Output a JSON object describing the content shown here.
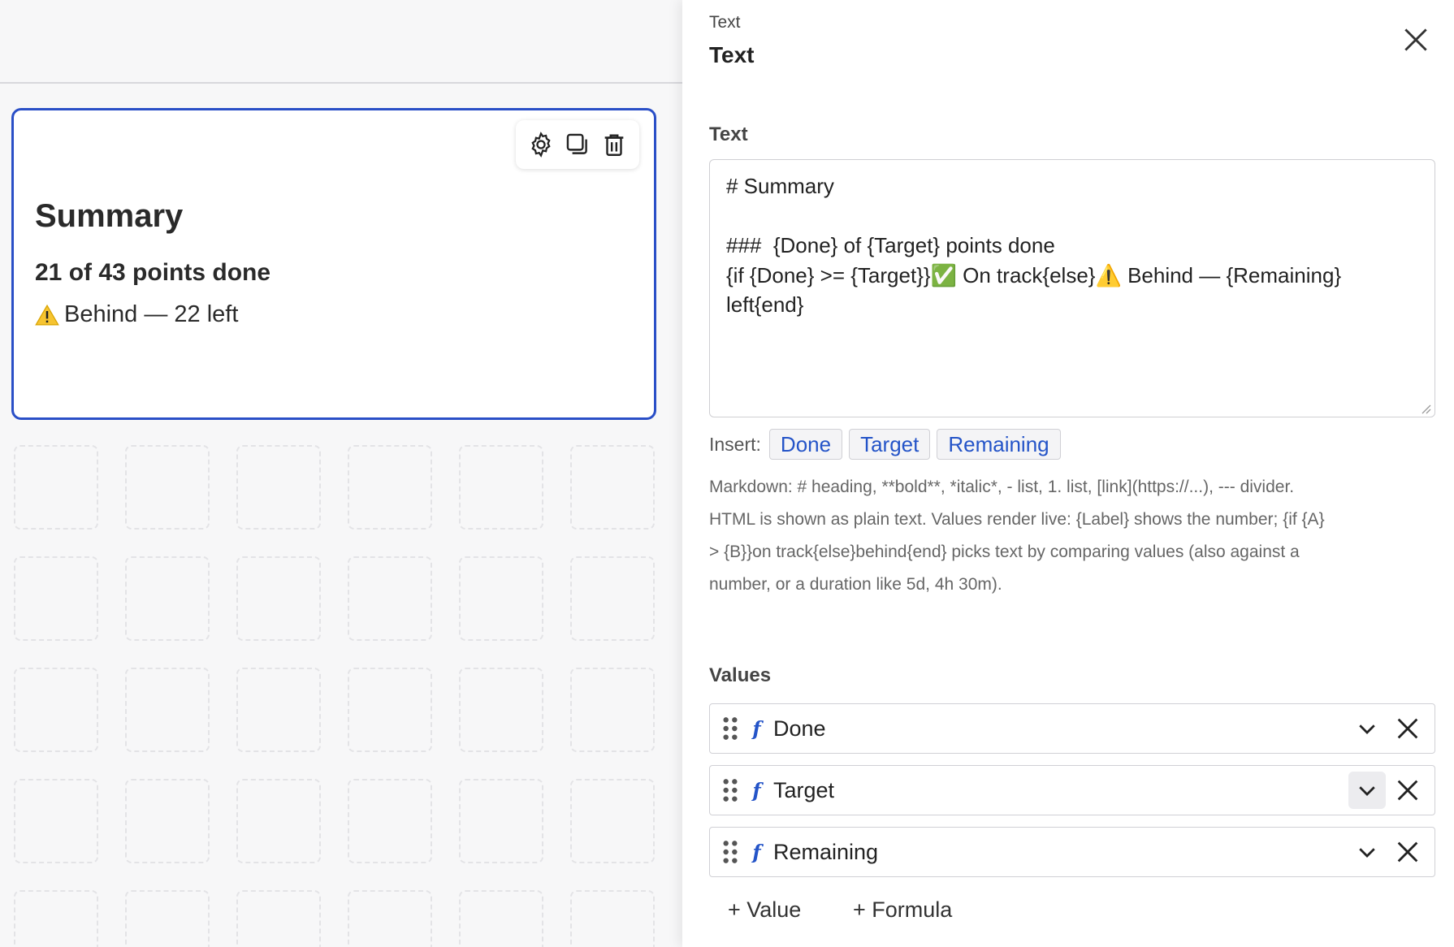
{
  "widget": {
    "title": "Summary",
    "subtitle": "21 of 43 points done",
    "status": "Behind — 22 left",
    "toolbar_icons": [
      "gear-icon",
      "duplicate-icon",
      "trash-icon"
    ]
  },
  "panel": {
    "kicker": "Text",
    "title": "Text",
    "text_section_label": "Text",
    "text_value": "# Summary\n\n###  {Done} of {Target} points done\n{if {Done} >= {Target}}✅ On track{else}⚠️ Behind — {Remaining}\nleft{end}",
    "insert_label": "Insert:",
    "insert_chips": [
      "Done",
      "Target",
      "Remaining"
    ],
    "help_text": "Markdown: # heading, **bold**, *italic*, - list, 1. list, [link](https://...), --- divider. HTML is shown as plain text. Values render live: {Label} shows the number; {if {A} > {B}}on track{else}behind{end} picks text by comparing values (also against a number, or a duration like 5d, 4h 30m).",
    "values_label": "Values",
    "values": [
      "Done",
      "Target",
      "Remaining"
    ],
    "add_value_label": "+ Value",
    "add_formula_label": "+ Formula"
  },
  "colors": {
    "accent": "#2a4fc7",
    "chip_text": "#2454c8"
  }
}
